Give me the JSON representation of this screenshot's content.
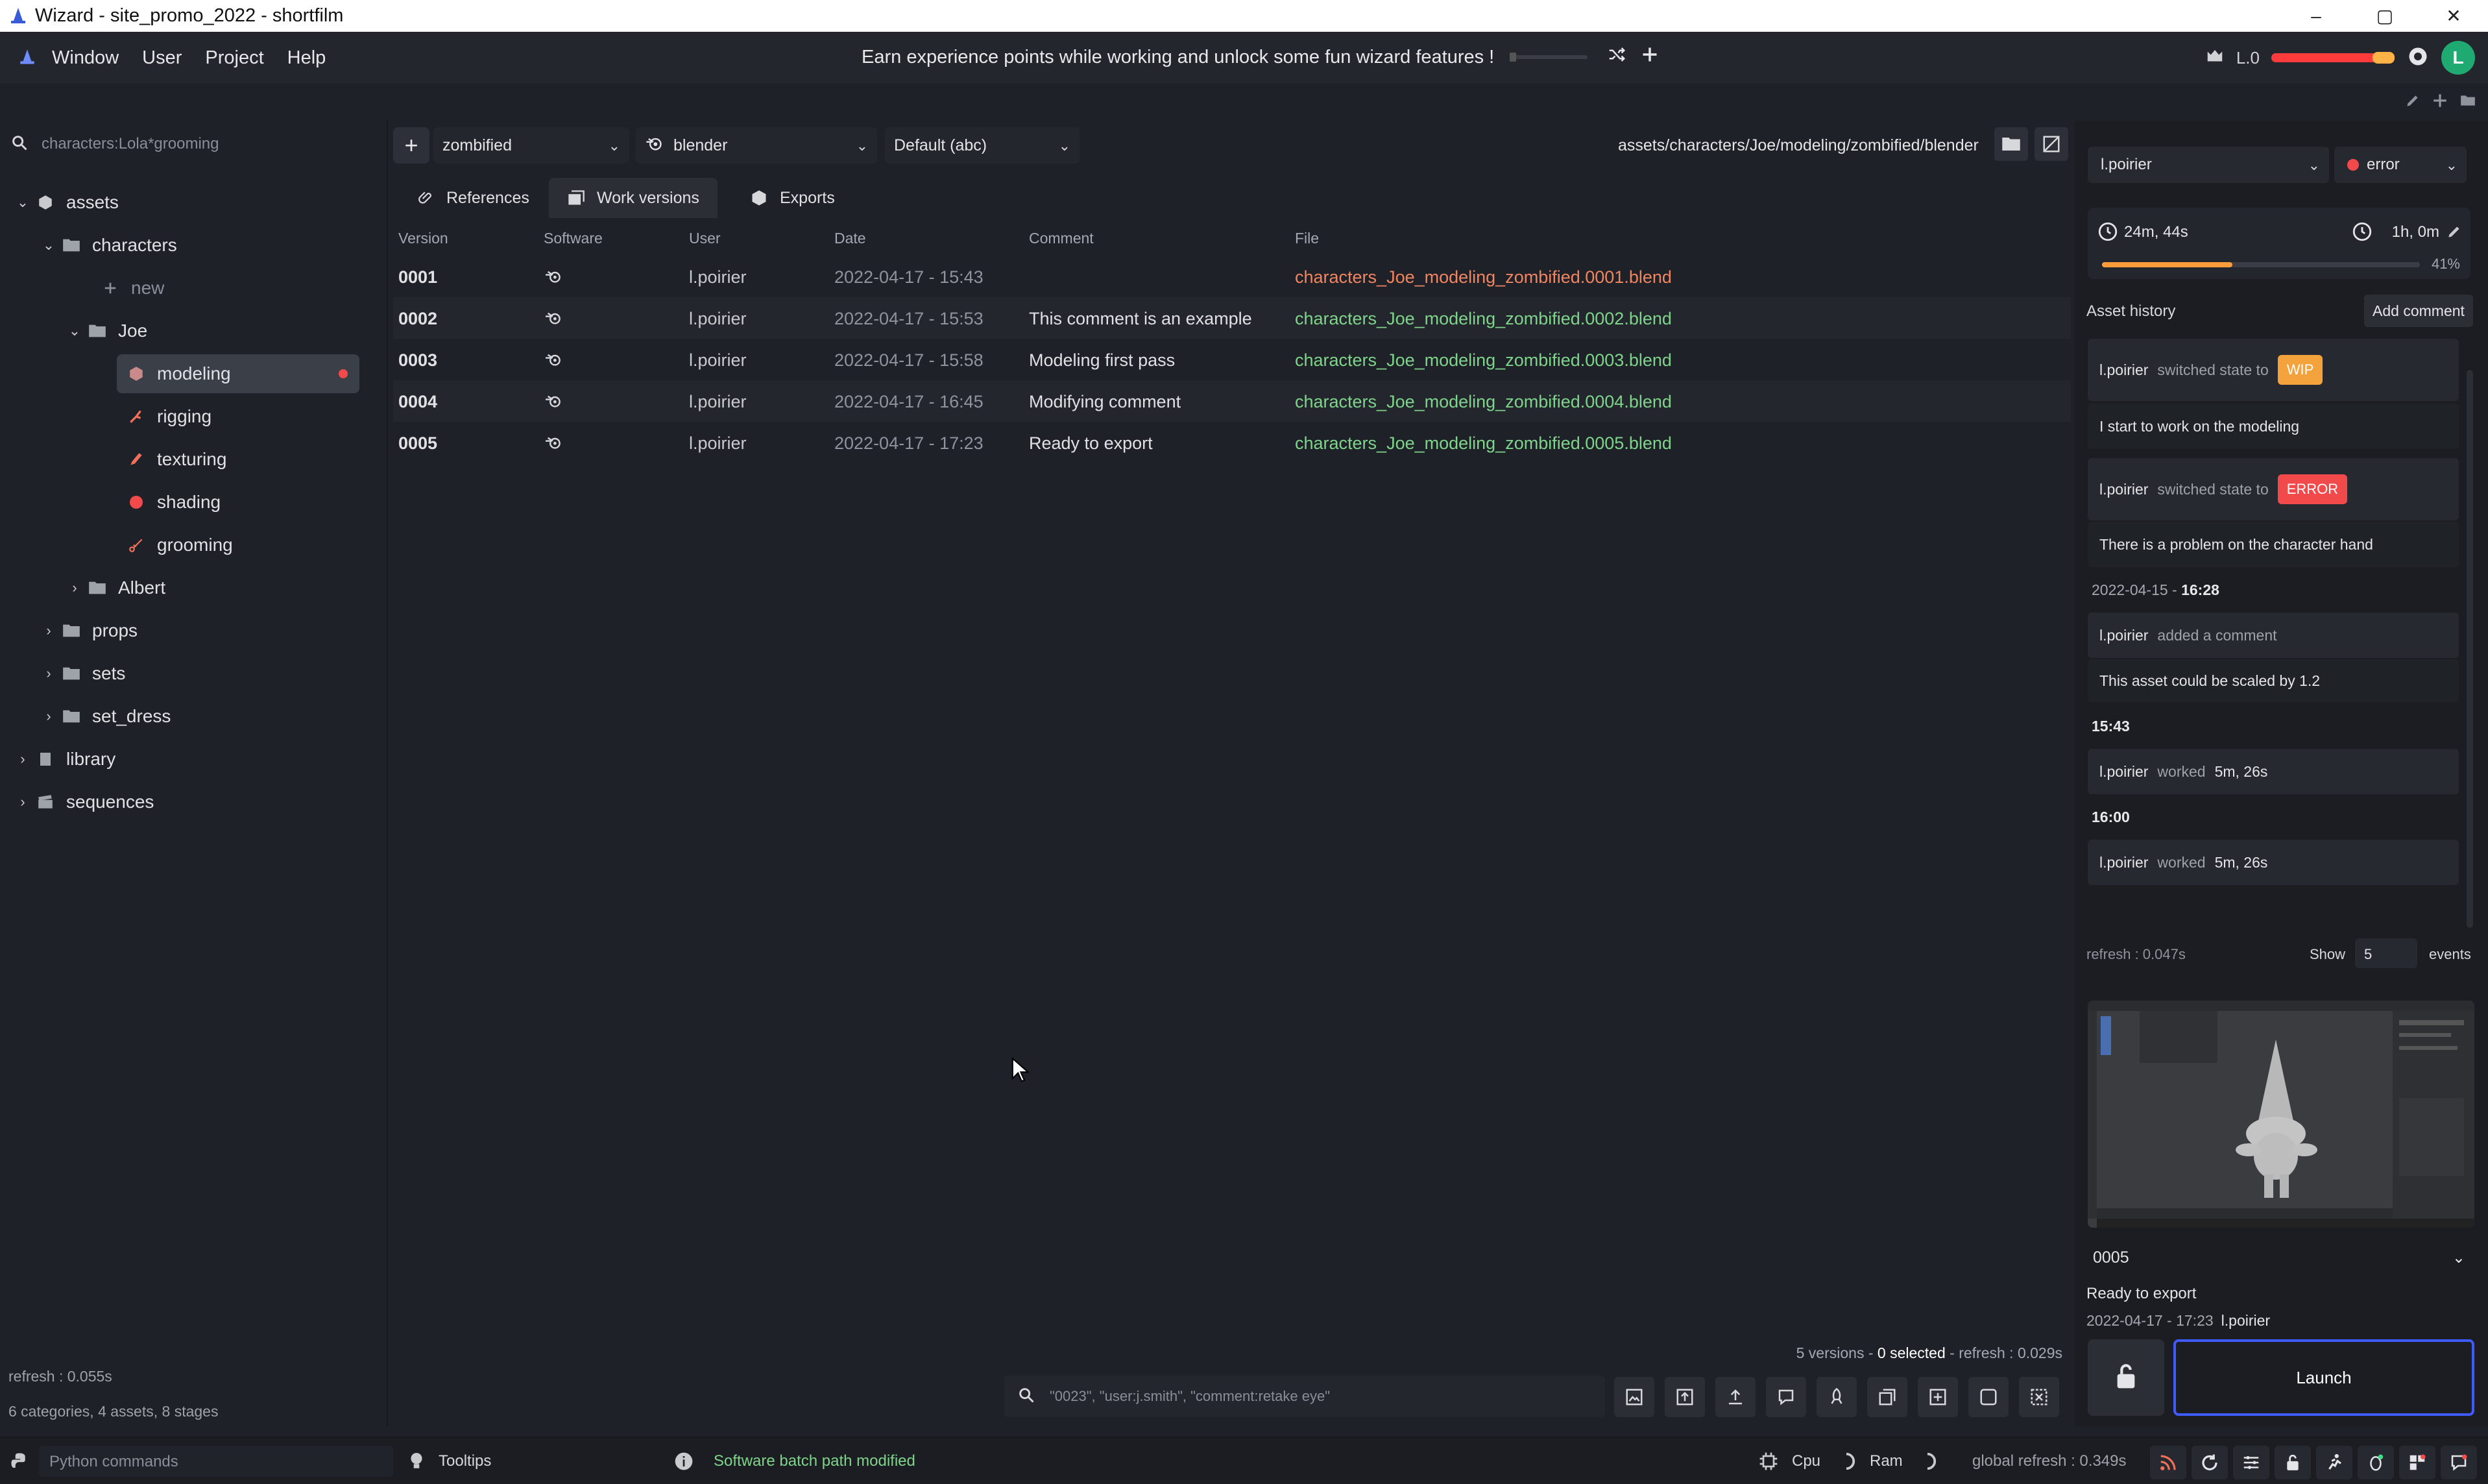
{
  "window": {
    "title": "Wizard - site_promo_2022 - shortfilm",
    "controls": [
      "–",
      "▢",
      "✕"
    ]
  },
  "menubar": {
    "items": [
      "Window",
      "User",
      "Project",
      "Help"
    ],
    "center_message": "Earn experience points while working and unlock some fun wizard features !",
    "level": "L.0",
    "avatar_letter": "L"
  },
  "left": {
    "search_placeholder": "characters:Lola*grooming",
    "tree": {
      "assets": "assets",
      "characters": "characters",
      "new": "new",
      "joe": "Joe",
      "modeling": "modeling",
      "rigging": "rigging",
      "texturing": "texturing",
      "shading": "shading",
      "grooming": "grooming",
      "albert": "Albert",
      "props": "props",
      "sets": "sets",
      "set_dress": "set_dress",
      "library": "library",
      "sequences": "sequences"
    },
    "refresh": "refresh : 0.055s",
    "summary": "6 categories, 4 assets, 8 stages"
  },
  "center": {
    "variant": "zombified",
    "software": "blender",
    "export_mode": "Default (abc)",
    "path": "assets/characters/Joe/modeling/zombified/blender",
    "tabs": [
      "References",
      "Work versions",
      "Exports"
    ],
    "columns": [
      "Version",
      "Software",
      "User",
      "Date",
      "Comment",
      "File"
    ],
    "rows": [
      {
        "version": "0001",
        "user": "l.poirier",
        "date": "2022-04-17 - 15:43",
        "comment": "",
        "file": "characters_Joe_modeling_zombified.0001.blend"
      },
      {
        "version": "0002",
        "user": "l.poirier",
        "date": "2022-04-17 - 15:53",
        "comment": "This comment is an example",
        "file": "characters_Joe_modeling_zombified.0002.blend"
      },
      {
        "version": "0003",
        "user": "l.poirier",
        "date": "2022-04-17 - 15:58",
        "comment": "Modeling first pass",
        "file": "characters_Joe_modeling_zombified.0003.blend"
      },
      {
        "version": "0004",
        "user": "l.poirier",
        "date": "2022-04-17 - 16:45",
        "comment": "Modifying comment",
        "file": "characters_Joe_modeling_zombified.0004.blend"
      },
      {
        "version": "0005",
        "user": "l.poirier",
        "date": "2022-04-17 - 17:23",
        "comment": "Ready to export",
        "file": "characters_Joe_modeling_zombified.0005.blend"
      }
    ],
    "status_versions": "5 versions - ",
    "status_selected": "0 selected",
    "status_refresh": " - refresh : 0.029s",
    "search_placeholder": "\"0023\", \"user:j.smith\", \"comment:retake eye\""
  },
  "right": {
    "user": "l.poirier",
    "state": "error",
    "time_spent": "24m, 44s",
    "estimated": "1h, 0m",
    "progress_percent": 41,
    "progress_label": "41%",
    "history_title": "Asset history",
    "add_comment": "Add comment",
    "events": {
      "e1_user": "l.poirier",
      "e1_verb": "switched state to",
      "e1_badge": "WIP",
      "e1_comment": "I start to work on the modeling",
      "e2_user": "l.poirier",
      "e2_verb": "switched state to",
      "e2_badge": "ERROR",
      "e2_comment": "There is a problem on the character hand",
      "ts1_date": "2022-04-15 - ",
      "ts1_time": "16:28",
      "e3_user": "l.poirier",
      "e3_verb": "added a comment",
      "e3_comment": "This asset could be scaled by 1.2",
      "ts2_time": "15:43",
      "e4_user": "l.poirier",
      "e4_verb": "worked",
      "e4_value": "5m, 26s",
      "ts3_time": "16:00",
      "e5_user": "l.poirier",
      "e5_verb": "worked",
      "e5_value": "5m, 26s"
    },
    "refresh": "refresh : 0.047s",
    "show_label": "Show",
    "show_value": "5",
    "events_label": "events",
    "selected_version": "0005",
    "version_comment": "Ready to export",
    "version_date": "2022-04-17 - 17:23",
    "version_user": "l.poirier",
    "launch": "Launch"
  },
  "statusbar": {
    "python_placeholder": "Python commands",
    "tooltips": "Tooltips",
    "message": "Software batch path modified",
    "cpu": "Cpu",
    "ram": "Ram",
    "global_refresh": "global refresh : 0.349s"
  },
  "colors": {
    "accent": "#3f5bff",
    "ok_file": "#7ed58a",
    "error_file": "#f28560",
    "wip": "#f4a23b",
    "error": "#f24a4a"
  }
}
